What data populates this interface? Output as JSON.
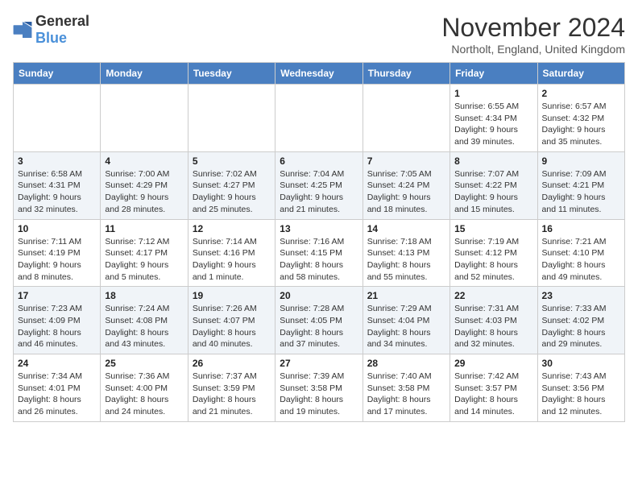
{
  "logo": {
    "general": "General",
    "blue": "Blue"
  },
  "title": "November 2024",
  "subtitle": "Northolt, England, United Kingdom",
  "weekdays": [
    "Sunday",
    "Monday",
    "Tuesday",
    "Wednesday",
    "Thursday",
    "Friday",
    "Saturday"
  ],
  "weeks": [
    [
      {
        "day": "",
        "info": ""
      },
      {
        "day": "",
        "info": ""
      },
      {
        "day": "",
        "info": ""
      },
      {
        "day": "",
        "info": ""
      },
      {
        "day": "",
        "info": ""
      },
      {
        "day": "1",
        "info": "Sunrise: 6:55 AM\nSunset: 4:34 PM\nDaylight: 9 hours and 39 minutes."
      },
      {
        "day": "2",
        "info": "Sunrise: 6:57 AM\nSunset: 4:32 PM\nDaylight: 9 hours and 35 minutes."
      }
    ],
    [
      {
        "day": "3",
        "info": "Sunrise: 6:58 AM\nSunset: 4:31 PM\nDaylight: 9 hours and 32 minutes."
      },
      {
        "day": "4",
        "info": "Sunrise: 7:00 AM\nSunset: 4:29 PM\nDaylight: 9 hours and 28 minutes."
      },
      {
        "day": "5",
        "info": "Sunrise: 7:02 AM\nSunset: 4:27 PM\nDaylight: 9 hours and 25 minutes."
      },
      {
        "day": "6",
        "info": "Sunrise: 7:04 AM\nSunset: 4:25 PM\nDaylight: 9 hours and 21 minutes."
      },
      {
        "day": "7",
        "info": "Sunrise: 7:05 AM\nSunset: 4:24 PM\nDaylight: 9 hours and 18 minutes."
      },
      {
        "day": "8",
        "info": "Sunrise: 7:07 AM\nSunset: 4:22 PM\nDaylight: 9 hours and 15 minutes."
      },
      {
        "day": "9",
        "info": "Sunrise: 7:09 AM\nSunset: 4:21 PM\nDaylight: 9 hours and 11 minutes."
      }
    ],
    [
      {
        "day": "10",
        "info": "Sunrise: 7:11 AM\nSunset: 4:19 PM\nDaylight: 9 hours and 8 minutes."
      },
      {
        "day": "11",
        "info": "Sunrise: 7:12 AM\nSunset: 4:17 PM\nDaylight: 9 hours and 5 minutes."
      },
      {
        "day": "12",
        "info": "Sunrise: 7:14 AM\nSunset: 4:16 PM\nDaylight: 9 hours and 1 minute."
      },
      {
        "day": "13",
        "info": "Sunrise: 7:16 AM\nSunset: 4:15 PM\nDaylight: 8 hours and 58 minutes."
      },
      {
        "day": "14",
        "info": "Sunrise: 7:18 AM\nSunset: 4:13 PM\nDaylight: 8 hours and 55 minutes."
      },
      {
        "day": "15",
        "info": "Sunrise: 7:19 AM\nSunset: 4:12 PM\nDaylight: 8 hours and 52 minutes."
      },
      {
        "day": "16",
        "info": "Sunrise: 7:21 AM\nSunset: 4:10 PM\nDaylight: 8 hours and 49 minutes."
      }
    ],
    [
      {
        "day": "17",
        "info": "Sunrise: 7:23 AM\nSunset: 4:09 PM\nDaylight: 8 hours and 46 minutes."
      },
      {
        "day": "18",
        "info": "Sunrise: 7:24 AM\nSunset: 4:08 PM\nDaylight: 8 hours and 43 minutes."
      },
      {
        "day": "19",
        "info": "Sunrise: 7:26 AM\nSunset: 4:07 PM\nDaylight: 8 hours and 40 minutes."
      },
      {
        "day": "20",
        "info": "Sunrise: 7:28 AM\nSunset: 4:05 PM\nDaylight: 8 hours and 37 minutes."
      },
      {
        "day": "21",
        "info": "Sunrise: 7:29 AM\nSunset: 4:04 PM\nDaylight: 8 hours and 34 minutes."
      },
      {
        "day": "22",
        "info": "Sunrise: 7:31 AM\nSunset: 4:03 PM\nDaylight: 8 hours and 32 minutes."
      },
      {
        "day": "23",
        "info": "Sunrise: 7:33 AM\nSunset: 4:02 PM\nDaylight: 8 hours and 29 minutes."
      }
    ],
    [
      {
        "day": "24",
        "info": "Sunrise: 7:34 AM\nSunset: 4:01 PM\nDaylight: 8 hours and 26 minutes."
      },
      {
        "day": "25",
        "info": "Sunrise: 7:36 AM\nSunset: 4:00 PM\nDaylight: 8 hours and 24 minutes."
      },
      {
        "day": "26",
        "info": "Sunrise: 7:37 AM\nSunset: 3:59 PM\nDaylight: 8 hours and 21 minutes."
      },
      {
        "day": "27",
        "info": "Sunrise: 7:39 AM\nSunset: 3:58 PM\nDaylight: 8 hours and 19 minutes."
      },
      {
        "day": "28",
        "info": "Sunrise: 7:40 AM\nSunset: 3:58 PM\nDaylight: 8 hours and 17 minutes."
      },
      {
        "day": "29",
        "info": "Sunrise: 7:42 AM\nSunset: 3:57 PM\nDaylight: 8 hours and 14 minutes."
      },
      {
        "day": "30",
        "info": "Sunrise: 7:43 AM\nSunset: 3:56 PM\nDaylight: 8 hours and 12 minutes."
      }
    ]
  ]
}
